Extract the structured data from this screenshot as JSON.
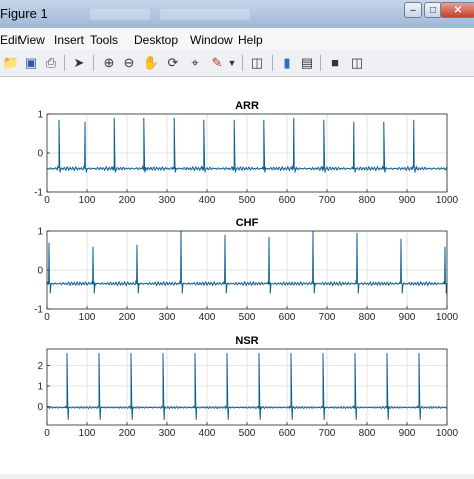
{
  "window": {
    "title": "Figure 1"
  },
  "menu": [
    "Edit",
    "View",
    "Insert",
    "Tools",
    "Desktop",
    "Window",
    "Help"
  ],
  "toolbar": [
    "open-folder-icon",
    "save-icon",
    "print-icon",
    "select-arrow-icon",
    "zoom-in-icon",
    "zoom-out-icon",
    "pan-hand-icon",
    "rotate-3d-icon",
    "data-cursor-icon",
    "brush-icon",
    "brush-dropdown-icon",
    "link-plot-icon",
    "colorbar-icon",
    "legend-icon",
    "hide-plot-tools-icon",
    "show-plot-tools-icon"
  ],
  "chart_data": [
    {
      "type": "line",
      "title": "ARR",
      "xlim": [
        0,
        1000
      ],
      "ylim": [
        -1,
        1
      ],
      "xticks": [
        "0",
        "100",
        "200",
        "300",
        "400",
        "500",
        "600",
        "700",
        "800",
        "900",
        "1000"
      ],
      "yticks": [
        "1",
        "0",
        "-1"
      ],
      "grid": true,
      "baseline": -0.4,
      "peaks": [
        {
          "x": 30,
          "y": 0.85
        },
        {
          "x": 95,
          "y": 0.8
        },
        {
          "x": 168,
          "y": 0.9
        },
        {
          "x": 242,
          "y": 0.9
        },
        {
          "x": 318,
          "y": 0.9
        },
        {
          "x": 392,
          "y": 0.85
        },
        {
          "x": 468,
          "y": 0.85
        },
        {
          "x": 542,
          "y": 0.85
        },
        {
          "x": 617,
          "y": 0.9
        },
        {
          "x": 692,
          "y": 0.85
        },
        {
          "x": 767,
          "y": 0.8
        },
        {
          "x": 842,
          "y": 0.8
        },
        {
          "x": 917,
          "y": 0.85
        }
      ],
      "troughs": -0.5
    },
    {
      "type": "line",
      "title": "CHF",
      "xlim": [
        0,
        1000
      ],
      "ylim": [
        -1,
        1
      ],
      "xticks": [
        "0",
        "100",
        "200",
        "300",
        "400",
        "500",
        "600",
        "700",
        "800",
        "900",
        "1000"
      ],
      "yticks": [
        "1",
        "0",
        "-1"
      ],
      "grid": true,
      "baseline": -0.35,
      "peaks": [
        {
          "x": 5,
          "y": 0.7
        },
        {
          "x": 115,
          "y": 0.6
        },
        {
          "x": 225,
          "y": 0.65
        },
        {
          "x": 335,
          "y": 1.0
        },
        {
          "x": 445,
          "y": 0.9
        },
        {
          "x": 555,
          "y": 0.85
        },
        {
          "x": 665,
          "y": 1.0
        },
        {
          "x": 775,
          "y": 0.95
        },
        {
          "x": 885,
          "y": 0.8
        },
        {
          "x": 995,
          "y": 0.6
        }
      ],
      "troughs": -0.6
    },
    {
      "type": "line",
      "title": "NSR",
      "xlim": [
        0,
        1000
      ],
      "ylim": [
        -0.9,
        2.8
      ],
      "xticks": [
        "0",
        "100",
        "200",
        "300",
        "400",
        "500",
        "600",
        "700",
        "800",
        "900",
        "1000"
      ],
      "yticks": [
        "2",
        "1",
        "0"
      ],
      "grid": true,
      "baseline": -0.05,
      "peaks": [
        {
          "x": 50,
          "y": 2.6
        },
        {
          "x": 130,
          "y": 2.6
        },
        {
          "x": 210,
          "y": 2.6
        },
        {
          "x": 290,
          "y": 2.6
        },
        {
          "x": 370,
          "y": 2.6
        },
        {
          "x": 450,
          "y": 2.6
        },
        {
          "x": 530,
          "y": 2.6
        },
        {
          "x": 610,
          "y": 2.6
        },
        {
          "x": 690,
          "y": 2.6
        },
        {
          "x": 770,
          "y": 2.6
        },
        {
          "x": 850,
          "y": 2.6
        },
        {
          "x": 930,
          "y": 2.6
        }
      ],
      "troughs": -0.65
    }
  ]
}
